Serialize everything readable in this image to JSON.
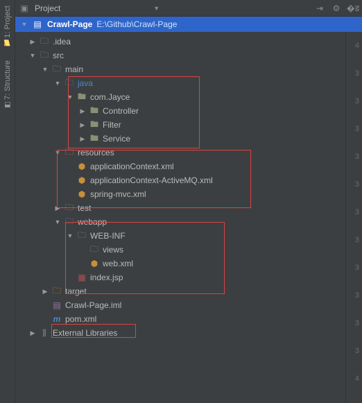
{
  "sidebar": {
    "tabs": [
      "1: Project",
      "7: Structure"
    ]
  },
  "toolbar": {
    "title": "Project"
  },
  "root": {
    "name": "Crawl-Page",
    "path": "E:\\Github\\Crawl-Page"
  },
  "tree": {
    "idea": ".idea",
    "src": "src",
    "main": "main",
    "java": "java",
    "pkg": "com.Jayce",
    "controller": "Controller",
    "filter": "Filter",
    "service": "Service",
    "resources": "resources",
    "appCtx": "applicationContext.xml",
    "appCtxMq": "applicationContext-ActiveMQ.xml",
    "springMvc": "spring-mvc.xml",
    "test": "test",
    "webapp": "webapp",
    "webinf": "WEB-INF",
    "views": "views",
    "webxml": "web.xml",
    "indexjsp": "index.jsp",
    "target": "target",
    "iml": "Crawl-Page.iml",
    "pom": "pom.xml",
    "extlib": "External Libraries"
  },
  "gutter": [
    "4",
    "3",
    "3",
    "3",
    "3",
    "3",
    "3",
    "3",
    "3",
    "3",
    "3",
    "3",
    "4"
  ]
}
